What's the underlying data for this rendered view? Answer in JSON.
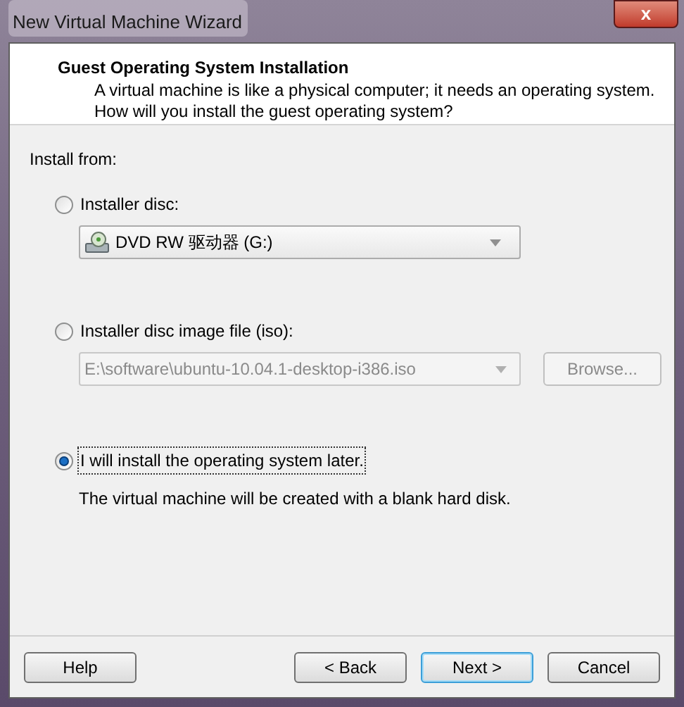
{
  "window": {
    "title": "New Virtual Machine Wizard",
    "close": "x"
  },
  "header": {
    "title": "Guest Operating System Installation",
    "description": "A virtual machine is like a physical computer; it needs an operating system. How will you install the guest operating system?"
  },
  "install_from": "Install from:",
  "options": [
    {
      "kind": "dropdown",
      "label": "Installer disc:",
      "selected": false,
      "value": "DVD RW 驱动器 (G:)",
      "disabled": false
    },
    {
      "kind": "file",
      "label": "Installer disc image file (iso):",
      "selected": false,
      "value": "E:\\software\\ubuntu-10.04.1-desktop-i386.iso",
      "disabled": true,
      "browse": "Browse..."
    },
    {
      "kind": "note",
      "label": "I will install the operating system later.",
      "selected": true,
      "note": "The virtual machine will be created with a blank hard disk."
    }
  ],
  "buttons": [
    {
      "label": "Help",
      "default": false
    },
    {
      "label": "< Back",
      "default": false
    },
    {
      "label": "Next >",
      "default": true
    },
    {
      "label": "Cancel",
      "default": false
    }
  ]
}
